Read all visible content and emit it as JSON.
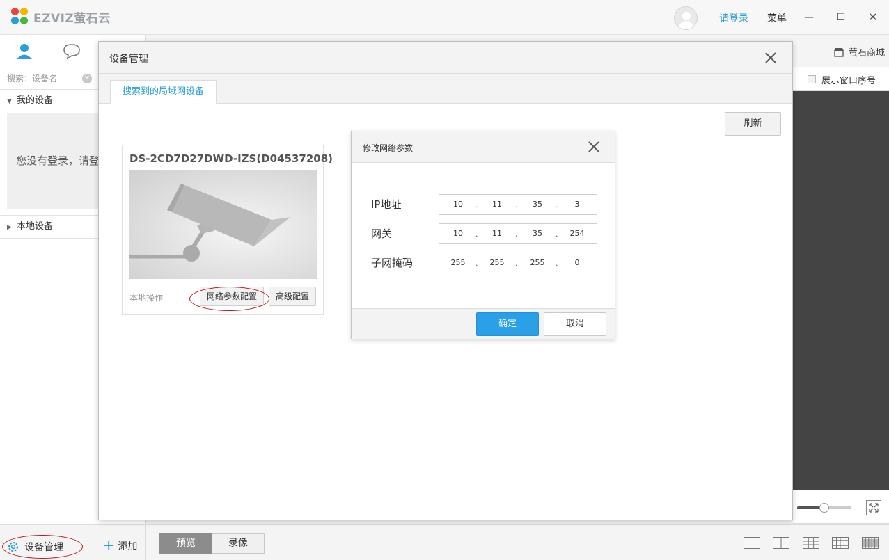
{
  "app": {
    "logo_text": "EZVIZ萤石云",
    "login_link": "请登录",
    "menu_label": "菜单",
    "minimize_glyph": "—",
    "maximize_glyph": "☐",
    "close_glyph": "✕"
  },
  "sidebar": {
    "search_placeholder": "搜索：设备名",
    "my_devices": "我的设备",
    "empty_message": "您没有登录，请登",
    "local_devices": "本地设备",
    "device_mgmt": "设备管理",
    "add_label": "添加"
  },
  "right_panel": {
    "store_label": "萤石商城",
    "show_window_index": "展示窗口序号",
    "zoom_slider_value": 0.5
  },
  "bottom_bar": {
    "preview_tab": "预览",
    "playback_tab": "录像"
  },
  "device_dialog": {
    "title": "设备管理",
    "tab_label": "搜索到的局域网设备",
    "refresh_label": "刷新",
    "card": {
      "device_name": "DS-2CD7D27DWD-IZS(D04537208)",
      "local_ops_label": "本地操作",
      "network_config_btn": "网络参数配置",
      "advanced_config_btn": "高级配置"
    }
  },
  "network_dialog": {
    "title": "修改网络参数",
    "rows": [
      {
        "label": "IP地址",
        "octets": [
          "10",
          "11",
          "35",
          "3"
        ]
      },
      {
        "label": "网关",
        "octets": [
          "10",
          "11",
          "35",
          "254"
        ]
      },
      {
        "label": "子网掩码",
        "octets": [
          "255",
          "255",
          "255",
          "0"
        ]
      }
    ],
    "ok_label": "确定",
    "cancel_label": "取消"
  },
  "colors": {
    "accent": "#2a9fd6",
    "primary_button": "#2aa0e8",
    "highlight_ring": "#c0151a",
    "video_area": "#444444"
  }
}
